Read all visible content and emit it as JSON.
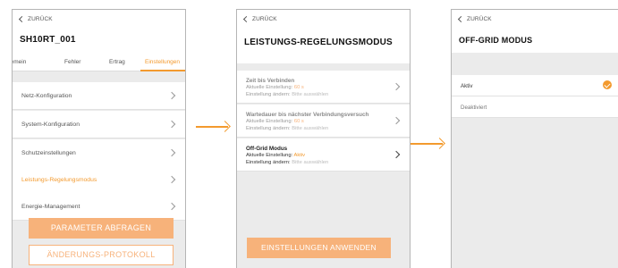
{
  "screen1": {
    "back_label": "ZURÜCK",
    "title": "SH10RT_001",
    "tabs": [
      "gemein",
      "Fehler",
      "Ertrag",
      "Einstellungen"
    ],
    "menu": [
      {
        "label": "Netz-Konfiguration"
      },
      {
        "label": "System-Konfiguration"
      },
      {
        "label": "Schutzeinstellungen"
      },
      {
        "label": "Leistungs-Regelungsmodus"
      },
      {
        "label": "Energie-Management"
      }
    ],
    "primary_button": "PARAMETER ABFRAGEN",
    "secondary_button": "ÄNDERUNGS-PROTOKOLL"
  },
  "screen2": {
    "back_label": "ZURÜCK",
    "title": "LEISTUNGS-REGELUNGSMODUS",
    "items": [
      {
        "name": "Zeit bis Verbinden",
        "current_prefix": "Aktuelle Einstellung:",
        "current_value": "60 s",
        "change_prefix": "Einstellung ändern:",
        "change_hint": "Bitte auswählen"
      },
      {
        "name": "Wartedauer bis nächster Verbindungsversuch",
        "current_prefix": "Aktuelle Einstellung:",
        "current_value": "60 s",
        "change_prefix": "Einstellung ändern:",
        "change_hint": "Bitte auswählen"
      },
      {
        "name": "Off-Grid Modus",
        "current_prefix": "Aktuelle Einstellung:",
        "current_value": "Aktiv",
        "change_prefix": "Einstellung ändern:",
        "change_hint": "Bitte auswählen"
      }
    ],
    "apply_button": "EINSTELLUNGEN ANWENDEN"
  },
  "screen3": {
    "back_label": "ZURÜCK",
    "title": "OFF-GRID MODUS",
    "options": [
      {
        "label": "Aktiv",
        "selected": true
      },
      {
        "label": "Deaktiviert",
        "selected": false
      }
    ]
  },
  "colors": {
    "accent": "#f39a2e",
    "accent_light": "#f7b27a",
    "panel_bg": "#ebebeb"
  }
}
